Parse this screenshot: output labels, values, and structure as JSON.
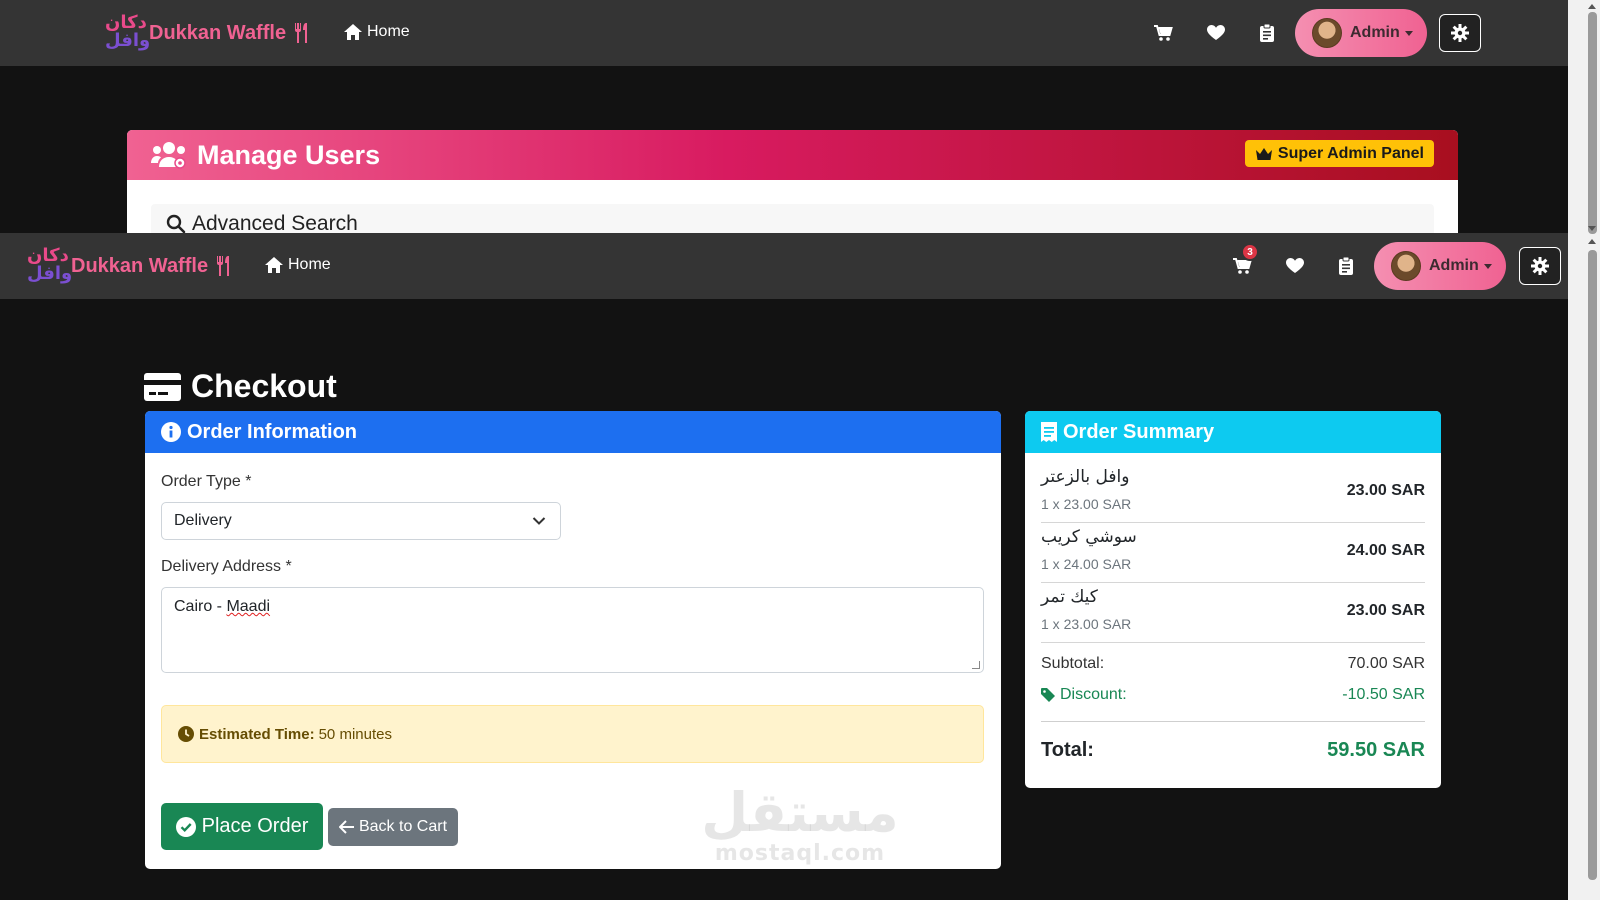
{
  "brand": {
    "name": "Dukkan Waffle",
    "logo_line1": "دكان",
    "logo_line2": "وافل"
  },
  "nav": {
    "home_label": "Home",
    "cart_count": "3",
    "admin_label": "Admin"
  },
  "bg_panel": {
    "title": "Manage Users",
    "badge": "Super Admin Panel",
    "search_label": "Advanced Search"
  },
  "page_title": "Checkout",
  "order_info": {
    "header": "Order Information",
    "order_type_label": "Order Type *",
    "order_type_value": "Delivery",
    "address_label": "Delivery Address *",
    "address_city": "Cairo - ",
    "address_area": "Maadi",
    "estimated_label": "Estimated Time:",
    "estimated_value": "50 minutes",
    "place_order_label": "Place Order",
    "back_label": "Back to Cart"
  },
  "order_summary": {
    "header": "Order Summary",
    "items": [
      {
        "name": "وافل بالزعتر",
        "qty": "1 x 23.00 SAR",
        "price": "23.00 SAR"
      },
      {
        "name": "سوشي كريب",
        "qty": "1 x 24.00 SAR",
        "price": "24.00 SAR"
      },
      {
        "name": "كيك تمر",
        "qty": "1 x 23.00 SAR",
        "price": "23.00 SAR"
      }
    ],
    "subtotal_label": "Subtotal:",
    "subtotal_value": "70.00 SAR",
    "discount_label": "Discount:",
    "discount_value": "-10.50 SAR",
    "total_label": "Total:",
    "total_value": "59.50 SAR"
  },
  "watermark": {
    "arabic": "مستقل",
    "latin": "mostaql.com"
  },
  "colors": {
    "navbar": "#343434",
    "brand_pink": "#f06292",
    "primary_blue": "#1d6ff0",
    "info_cyan": "#0dcaf0",
    "success_green": "#198754",
    "warning_yellow": "#ffc107"
  }
}
